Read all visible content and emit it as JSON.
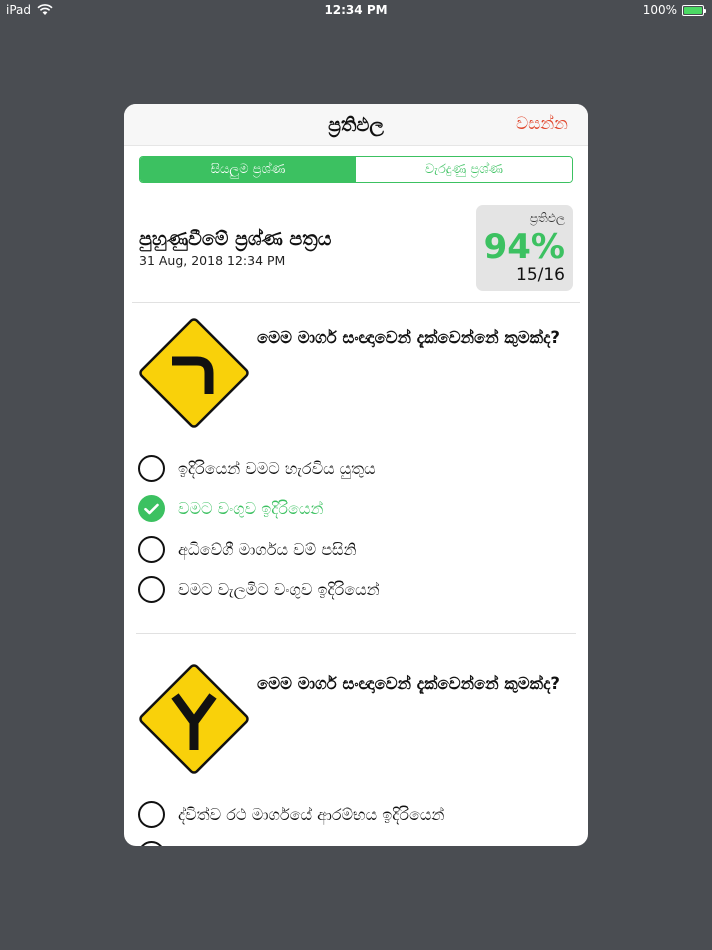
{
  "status_bar": {
    "device": "iPad",
    "time": "12:34 PM",
    "battery": "100%",
    "battery_level": 1.0
  },
  "modal": {
    "title": "ප්‍රතිඵල",
    "close_label": "වසන්න",
    "tabs": [
      "සියලුම ප්‍රශ්ණ",
      "වැරදුණු ප්‍රශ්ණ"
    ],
    "paper": {
      "title": "පුහුණුවීමේ ප්‍රශ්ණ පත්‍රය",
      "date": "31 Aug, 2018 12:34 PM"
    },
    "score": {
      "label": "ප්‍රතිඵල",
      "percent": "94%",
      "count": "15/16"
    }
  },
  "questions": [
    {
      "sign_icon": "curve-left-sign-icon",
      "text": "මෙම මාර්ග සංඥාවෙන් දැක්වෙන්නේ කුමක්ද?",
      "options": [
        {
          "label": "ඉදිරියෙන් වමට හැරවිය යුතුය",
          "selected": false
        },
        {
          "label": "වමට වංගුව ඉදිරියෙන්",
          "selected": true
        },
        {
          "label": "අධිවේගී මාර්ගය වම් පසිනි",
          "selected": false
        },
        {
          "label": "වමට වැලමිට වංගුව ඉදිරියෙන්",
          "selected": false
        }
      ]
    },
    {
      "sign_icon": "y-junction-sign-icon",
      "text": "මෙම මාර්ග සංඥාවෙන් දැක්වෙන්නේ කුමක්ද?",
      "options": [
        {
          "label": "ද්විත්ව රථ මාර්ගයේ ආරම්භය ඉදිරියෙන්",
          "selected": false
        }
      ]
    }
  ],
  "colors": {
    "accent": "#3cc161",
    "close": "#e0442a",
    "backdrop": "#4a4d52",
    "sign_yellow": "#f9d10a"
  }
}
